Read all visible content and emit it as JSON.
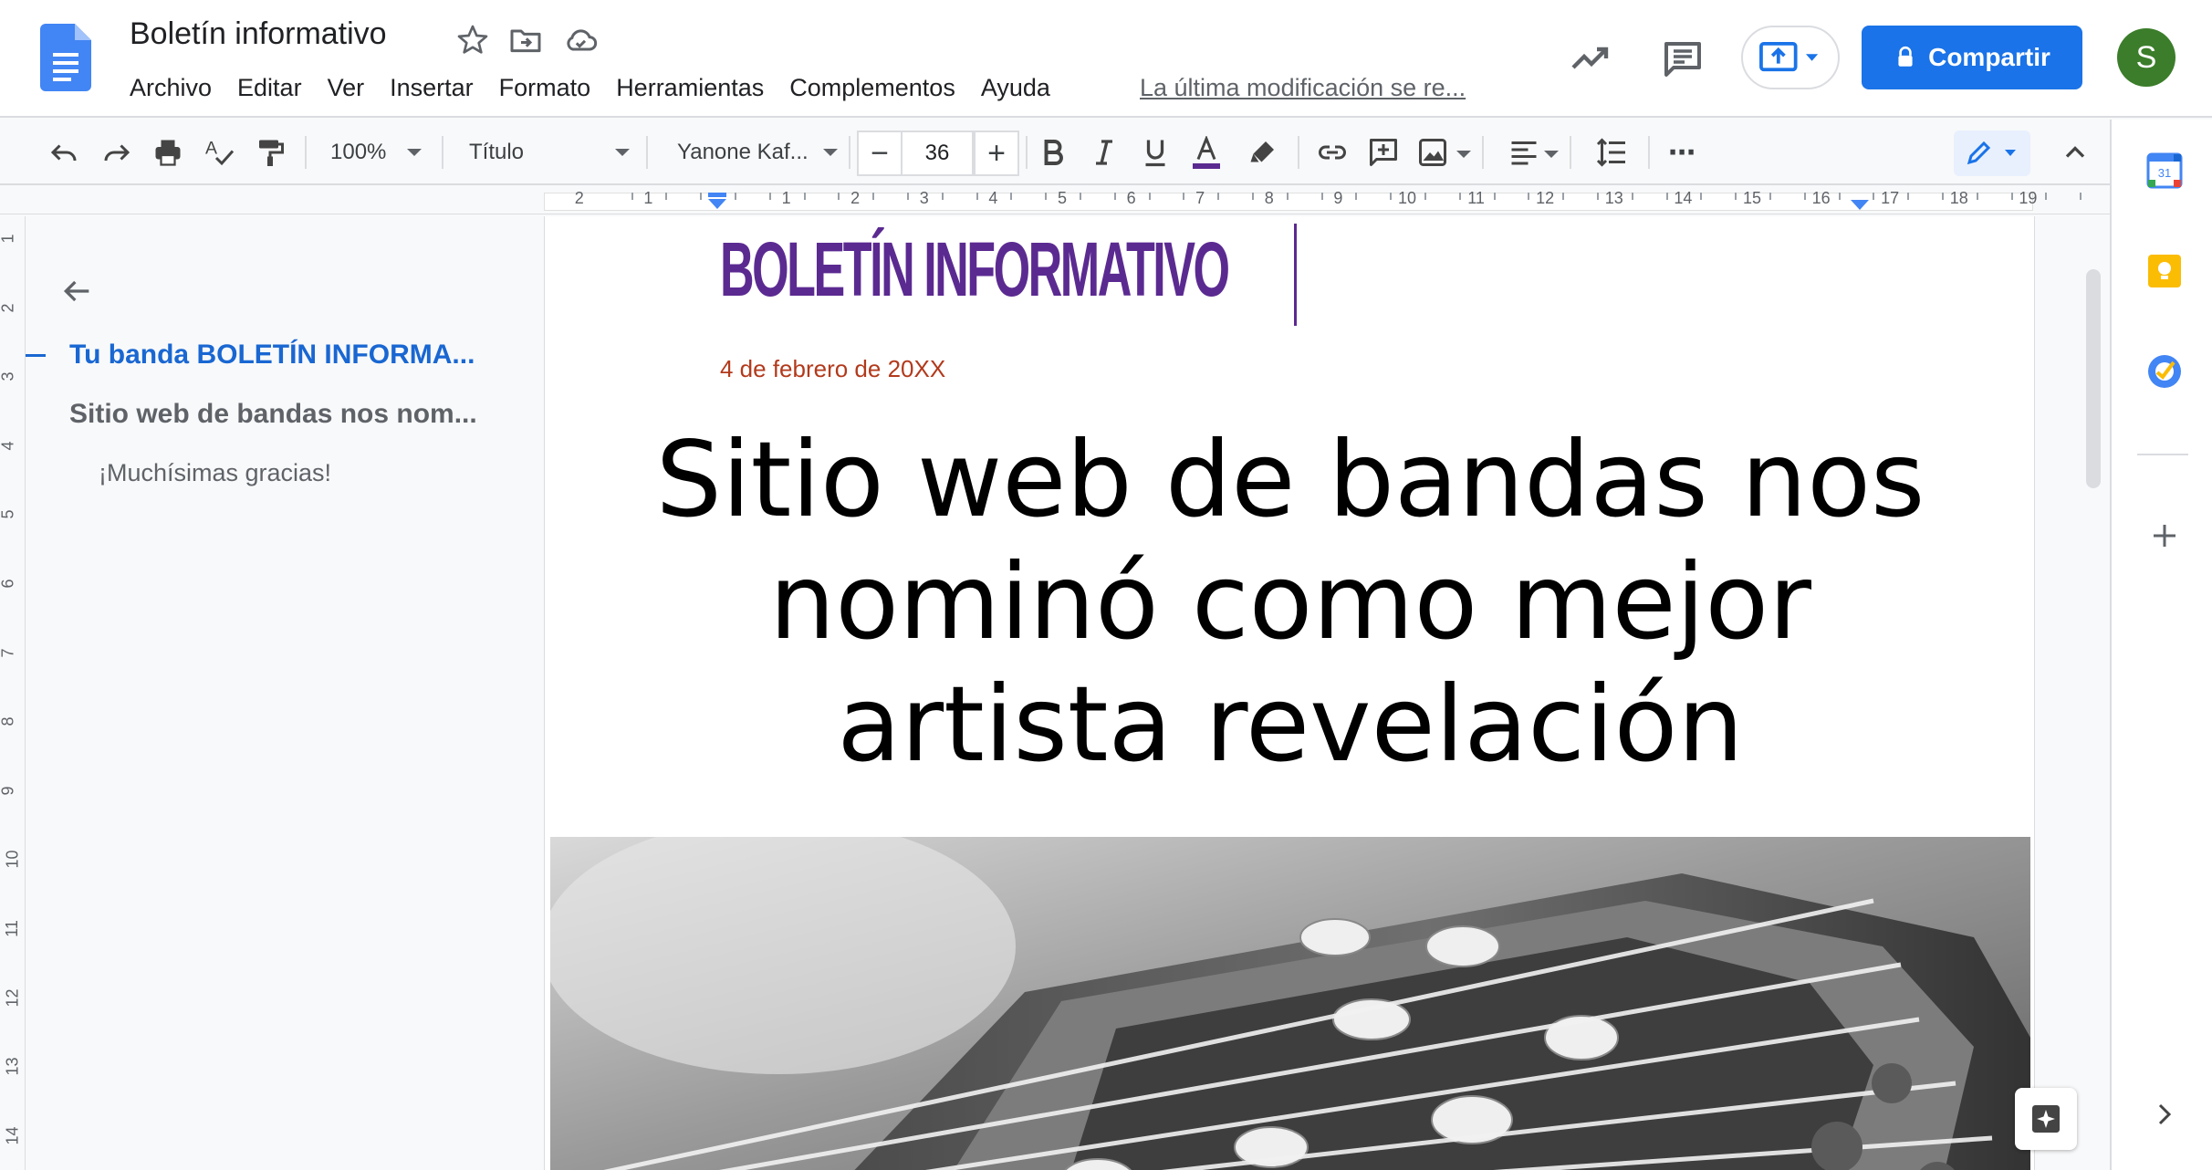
{
  "app": {
    "doc_title": "Boletín informativo",
    "menu": [
      "Archivo",
      "Editar",
      "Ver",
      "Insertar",
      "Formato",
      "Herramientas",
      "Complementos",
      "Ayuda"
    ],
    "last_edit": "La última modificación se re...",
    "share_label": "Compartir",
    "avatar_letter": "S"
  },
  "toolbar": {
    "zoom": "100%",
    "style": "Título",
    "font": "Yanone Kaf...",
    "font_size": "36",
    "minus": "−",
    "plus": "+",
    "more": "⋯"
  },
  "ruler": {
    "h_labels": [
      "2",
      "1",
      "1",
      "2",
      "3",
      "4",
      "5",
      "6",
      "7",
      "8",
      "9",
      "10",
      "11",
      "12",
      "13",
      "14",
      "15",
      "16",
      "17",
      "18",
      "19"
    ],
    "v_labels": [
      "1",
      "2",
      "3",
      "4",
      "5",
      "6",
      "7",
      "8",
      "9",
      "10",
      "11",
      "12",
      "13",
      "14"
    ]
  },
  "outline": {
    "items": [
      {
        "label": "Tu banda BOLETÍN INFORMA..."
      },
      {
        "label": "Sitio web de bandas nos nom..."
      },
      {
        "label": "¡Muchísimas gracias!"
      }
    ]
  },
  "document": {
    "heading": "BOLETÍN INFORMATIVO",
    "date": "4 de febrero de 20XX",
    "headline_lines": [
      "Sitio web de bandas nos",
      "nominó como mejor",
      "artista revelación"
    ]
  },
  "colors": {
    "accent": "#1a73e8",
    "heading": "#5b2a91",
    "date": "#b23a1c",
    "outline_active": "#1967d2",
    "avatar": "#3b7d2a"
  },
  "icons": {
    "title_bar": [
      "docs-logo-icon",
      "star-icon",
      "move-to-folder-icon",
      "cloud-saved-icon",
      "activity-trend-icon",
      "comments-icon",
      "present-icon",
      "lock-icon"
    ],
    "side_panel": [
      "calendar-icon",
      "keep-icon",
      "tasks-icon",
      "add-icon",
      "chevron-right-icon"
    ]
  }
}
